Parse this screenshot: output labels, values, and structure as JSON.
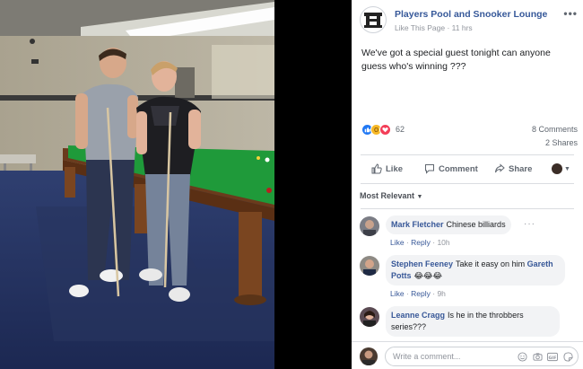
{
  "post": {
    "page_name": "Players Pool and Snooker Lounge",
    "like_page": "Like This Page",
    "separator": "·",
    "time": "11 hrs",
    "text": "We've got a special guest tonight can anyone guess who's winning ???",
    "reaction_count": "62",
    "comments_count": "8 Comments",
    "shares_count": "2 Shares",
    "actions": {
      "like": "Like",
      "comment": "Comment",
      "share": "Share"
    }
  },
  "comments_section": {
    "sort_label": "Most Relevant",
    "comments": [
      {
        "author": "Mark Fletcher",
        "text": "Chinese billiards",
        "like": "Like",
        "reply": "Reply",
        "time": "10h"
      },
      {
        "author": "Stephen Feeney",
        "text": "Take it easy on him",
        "mention": "Gareth Potts",
        "emoji": "😂😂😂",
        "like": "Like",
        "reply": "Reply",
        "time": "9h"
      },
      {
        "author": "Leanne Cragg",
        "text": "Is he in the throbbers series???"
      }
    ],
    "write_placeholder": "Write a comment...",
    "write_icons": [
      "emoji-icon",
      "camera-icon",
      "gif-icon",
      "sticker-icon"
    ]
  },
  "colors": {
    "link_blue": "#365899",
    "meta_gray": "#90949c",
    "like_blue": "#2078f4",
    "love_red": "#f33e58",
    "wow_yellow": "#f7b928",
    "table_green": "#1f9a3a"
  }
}
